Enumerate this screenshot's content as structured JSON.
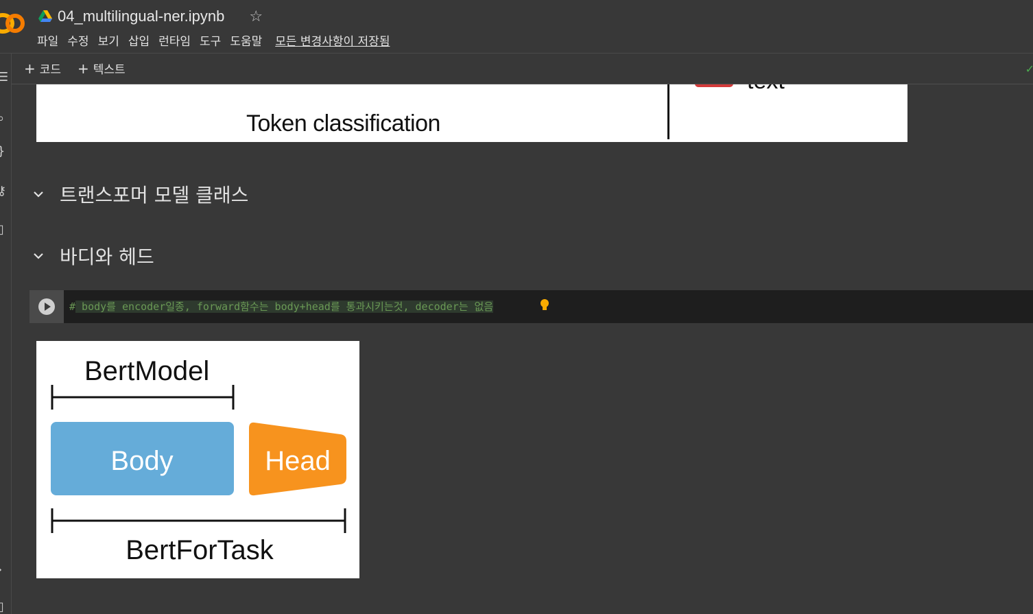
{
  "header": {
    "notebook_title": "04_multilingual-ner.ipynb",
    "menu": [
      "파일",
      "수정",
      "보기",
      "삽입",
      "런타임",
      "도구",
      "도움말"
    ],
    "save_status": "모든 변경사항이 저장됨"
  },
  "toolbar": {
    "add_code": "코드",
    "add_text": "텍스트"
  },
  "top_image": {
    "label": "Token classification",
    "partial_text": "text"
  },
  "sections": [
    {
      "title": "트랜스포머 모델 클래스"
    },
    {
      "title": "바디와 헤드"
    }
  ],
  "code_cell": {
    "hash": "#",
    "comment": " body를 encoder일종, forward함수는 body+head를 통과시키는것, decoder는 없음"
  },
  "diagram": {
    "bert_model_label": "BertModel",
    "body_label": "Body",
    "head_label": "Head",
    "bert_for_task_label": "BertForTask",
    "body_color": "#65acd9",
    "head_color": "#f7931e"
  },
  "colors": {
    "background": "#383838",
    "code_bg": "#1e1e1e",
    "comment": "#6a9955",
    "logo": "#f9ab00"
  }
}
